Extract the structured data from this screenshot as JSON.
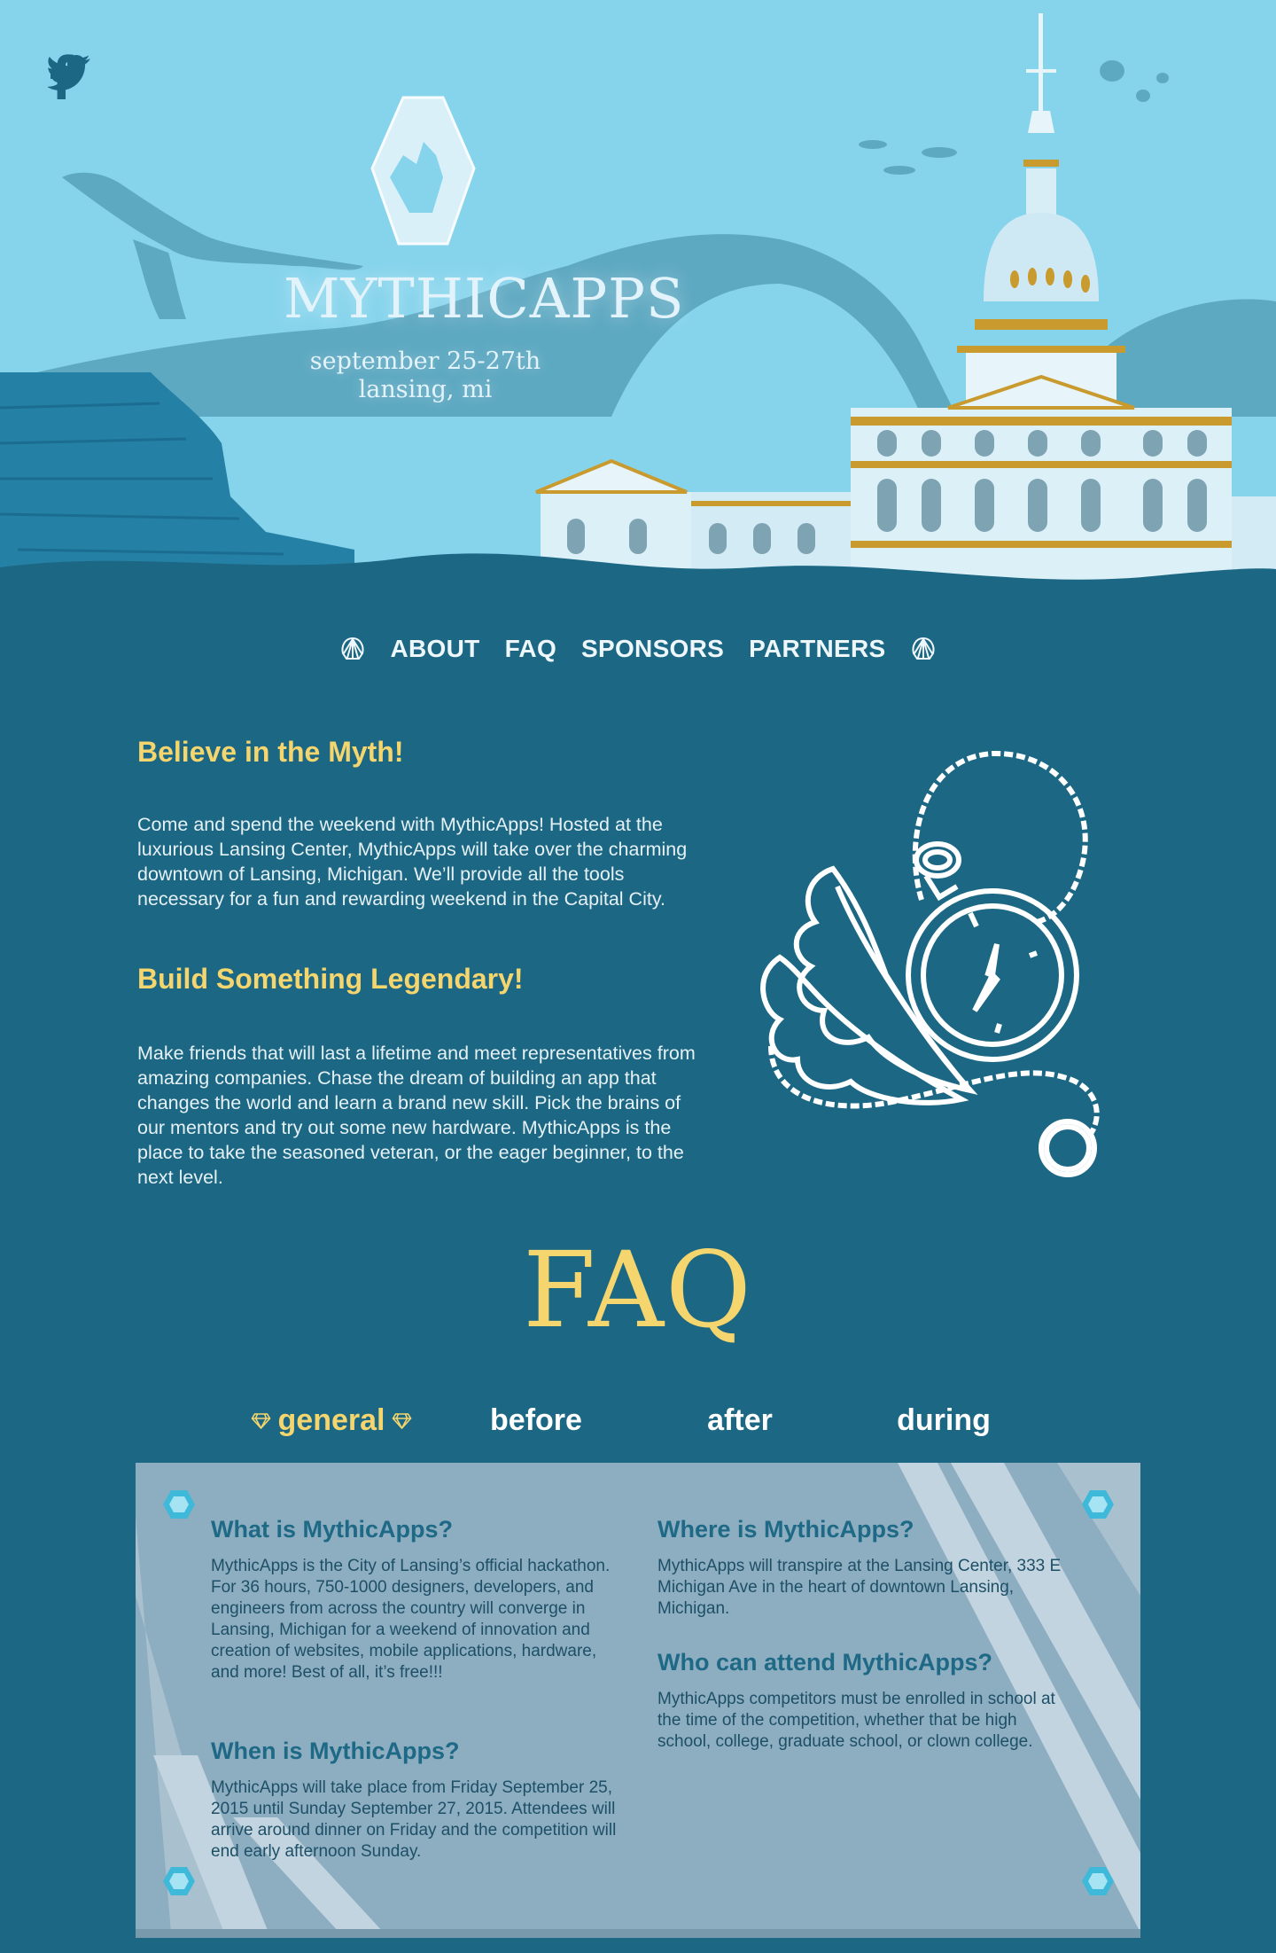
{
  "social": {
    "twitter_icon": "twitter-icon",
    "facebook_icon": "facebook-icon"
  },
  "brand": {
    "name": "MYTHICAPPS",
    "date_line": "september 25-27th",
    "location_line": "lansing, mi"
  },
  "nav": {
    "items": [
      "ABOUT",
      "FAQ",
      "SPONSORS",
      "PARTNERS"
    ]
  },
  "about": {
    "heading1": "Believe in the Myth!",
    "para1": "Come and spend the weekend with MythicApps! Hosted at the luxurious Lansing Center, MythicApps will take over the charming downtown of Lansing, Michigan. We’ll provide all the tools necessary for a fun and rewarding weekend in the Capital City.",
    "heading2": "Build Something Legendary!",
    "para2": "Make friends that will last a lifetime and meet representatives from amazing companies. Chase the dream of building an app that changes the world and learn a brand new skill. Pick the brains of our mentors and try out some new hardware. MythicApps is the place to take the seasoned veteran, or the eager beginner, to the next level."
  },
  "faq": {
    "title": "FAQ",
    "tabs": [
      "general",
      "before",
      "after",
      "during"
    ],
    "active_tab": "general",
    "questions": [
      {
        "q": "What is MythicApps?",
        "a": "MythicApps is the City of Lansing’s official hackathon. For 36 hours, 750-1000 designers, developers, and engineers from across the country will converge in Lansing, Michigan for a weekend of innovation and creation of websites, mobile applications, hardware, and more! Best of all, it’s free!!!"
      },
      {
        "q": "When is MythicApps?",
        "a": "MythicApps will take place from Friday September 25, 2015 until Sunday September 27, 2015. Attendees will arrive around dinner on Friday and the competition will end early afternoon Sunday."
      },
      {
        "q": "Where is MythicApps?",
        "a": "MythicApps will transpire at the Lansing Center, 333 E Michigan Ave in the heart of downtown Lansing, Michigan."
      },
      {
        "q": "Who can attend MythicApps?",
        "a": "MythicApps competitors must be enrolled in school at the time of the competition, whether that be high school, college, graduate school, or clown college."
      }
    ]
  },
  "colors": {
    "sky": "#86d4ec",
    "deep": "#1c6884",
    "gold": "#f5d56e",
    "panel": "#8dadc1",
    "heading": "#1e6985"
  }
}
